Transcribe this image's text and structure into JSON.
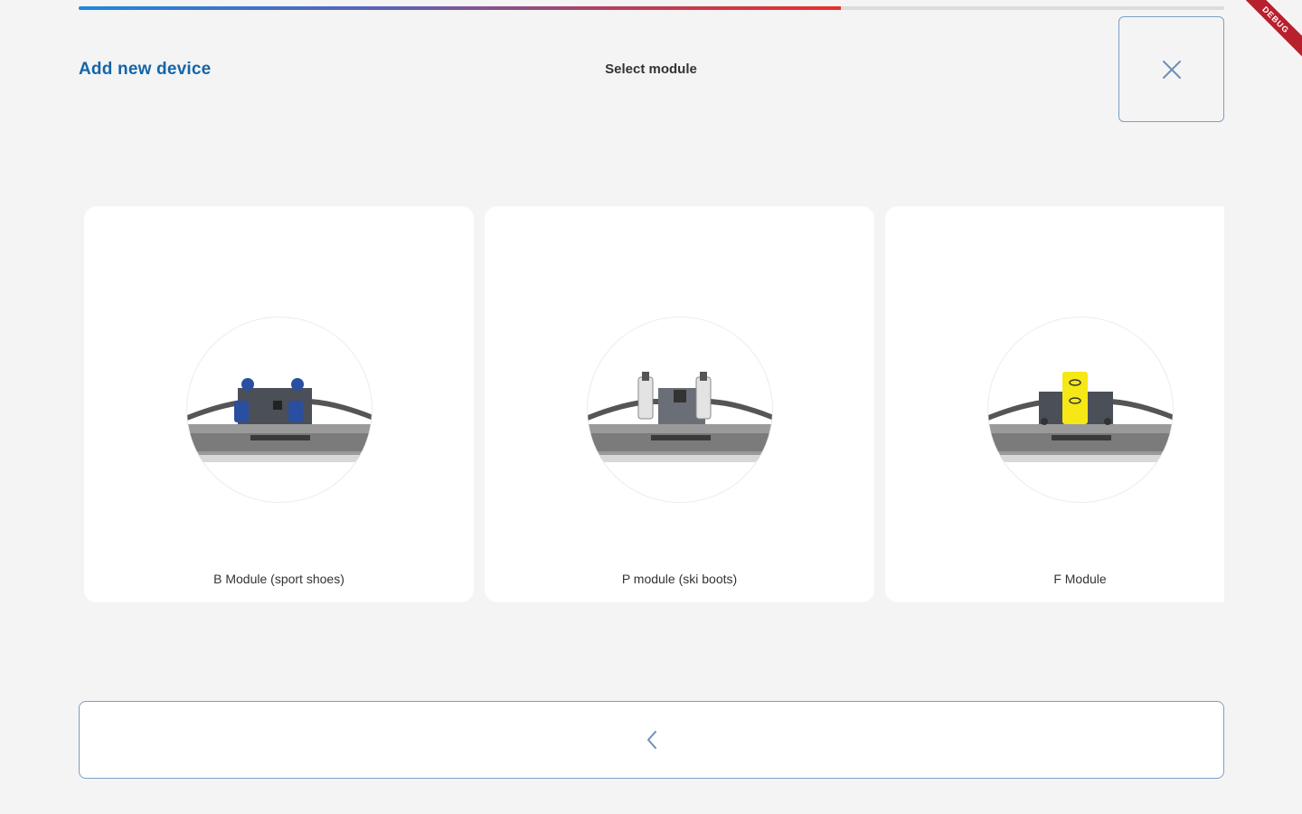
{
  "progress": {
    "fraction": 0.665
  },
  "header": {
    "title": "Add new device",
    "step_title": "Select module",
    "close_icon": "close-icon"
  },
  "debug_banner": {
    "label": "DEBUG"
  },
  "modules": [
    {
      "label": "B Module (sport shoes)",
      "accent": "#2a4fa0"
    },
    {
      "label": "P module (ski boots)",
      "accent": "#d9d9d9"
    },
    {
      "label": "F Module",
      "accent": "#f5e816"
    }
  ],
  "footer": {
    "back_icon": "chevron-left-icon"
  },
  "colors": {
    "brand_blue": "#1565a8",
    "border_blue": "#7c9ec4",
    "progress_start": "#1e86e0",
    "progress_end": "#e8302c",
    "background": "#f4f4f4"
  }
}
